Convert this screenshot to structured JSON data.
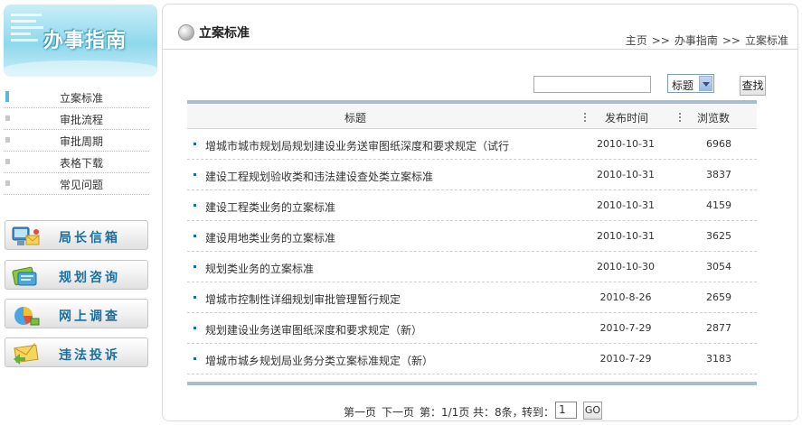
{
  "sidebar": {
    "banner_title": "办事指南",
    "menu": [
      {
        "label": "立案标准",
        "active": true
      },
      {
        "label": "审批流程",
        "active": false
      },
      {
        "label": "审批周期",
        "active": false
      },
      {
        "label": "表格下载",
        "active": false
      },
      {
        "label": "常见问题",
        "active": false
      }
    ],
    "buttons": [
      {
        "label": "局长信箱",
        "icon": "computer-mail-icon"
      },
      {
        "label": "规划咨询",
        "icon": "consult-icon"
      },
      {
        "label": "网上调查",
        "icon": "pie-chart-icon"
      },
      {
        "label": "违法投诉",
        "icon": "envelope-icon"
      }
    ]
  },
  "header": {
    "title": "立案标准",
    "breadcrumb": [
      "主页",
      "办事指南",
      "立案标准"
    ],
    "breadcrumb_separator": ">>"
  },
  "search": {
    "input_value": "",
    "select_value": "标题",
    "button_label": "查找"
  },
  "table": {
    "columns": [
      "标题",
      "发布时间",
      "浏览数"
    ],
    "rows": [
      {
        "title": "增城市城市规划局规划建设业务送审图纸深度和要求规定（试行",
        "date": "2010-10-31",
        "views": "6968"
      },
      {
        "title": "建设工程规划验收类和违法建设查处类立案标准",
        "date": "2010-10-31",
        "views": "3837"
      },
      {
        "title": "建设工程类业务的立案标准",
        "date": "2010-10-31",
        "views": "4159"
      },
      {
        "title": "建设用地类业务的立案标准",
        "date": "2010-10-31",
        "views": "3625"
      },
      {
        "title": "规划类业务的立案标准",
        "date": "2010-10-30",
        "views": "3054"
      },
      {
        "title": "增城市控制性详细规划审批管理暂行规定",
        "date": "2010-8-26",
        "views": "2659"
      },
      {
        "title": "规划建设业务送审图纸深度和要求规定（新）",
        "date": "2010-7-29",
        "views": "2877"
      },
      {
        "title": "增城市城乡规划局业务分类立案标准规定（新）",
        "date": "2010-7-29",
        "views": "3183"
      }
    ]
  },
  "pager": {
    "first": "第一页",
    "next": "下一页",
    "page_info": "第：1/1页",
    "total": "共：8条，",
    "goto_label": "转到：",
    "page_value": "1",
    "go_label": "GO"
  },
  "colors": {
    "accent_blue": "#1a6f9e",
    "banner_cyan": "#8ed8ec",
    "table_bar": "#a9bfc8"
  }
}
